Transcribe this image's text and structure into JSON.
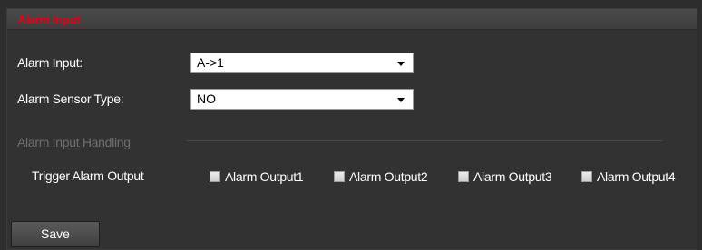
{
  "panel": {
    "title": "Alarm Input"
  },
  "form": {
    "alarm_input": {
      "label": "Alarm Input:",
      "value": "A->1"
    },
    "sensor_type": {
      "label": "Alarm Sensor Type:",
      "value": "NO"
    },
    "handling_section": "Alarm Input Handling",
    "trigger": {
      "label": "Trigger Alarm Output",
      "options": [
        {
          "label": "Alarm Output1",
          "checked": false
        },
        {
          "label": "Alarm Output2",
          "checked": false
        },
        {
          "label": "Alarm Output3",
          "checked": false
        },
        {
          "label": "Alarm Output4",
          "checked": false
        }
      ]
    }
  },
  "actions": {
    "save_label": "Save"
  },
  "colors": {
    "title": "#e4001b",
    "background": "#323232",
    "disabled_text": "#6e6e6e"
  }
}
